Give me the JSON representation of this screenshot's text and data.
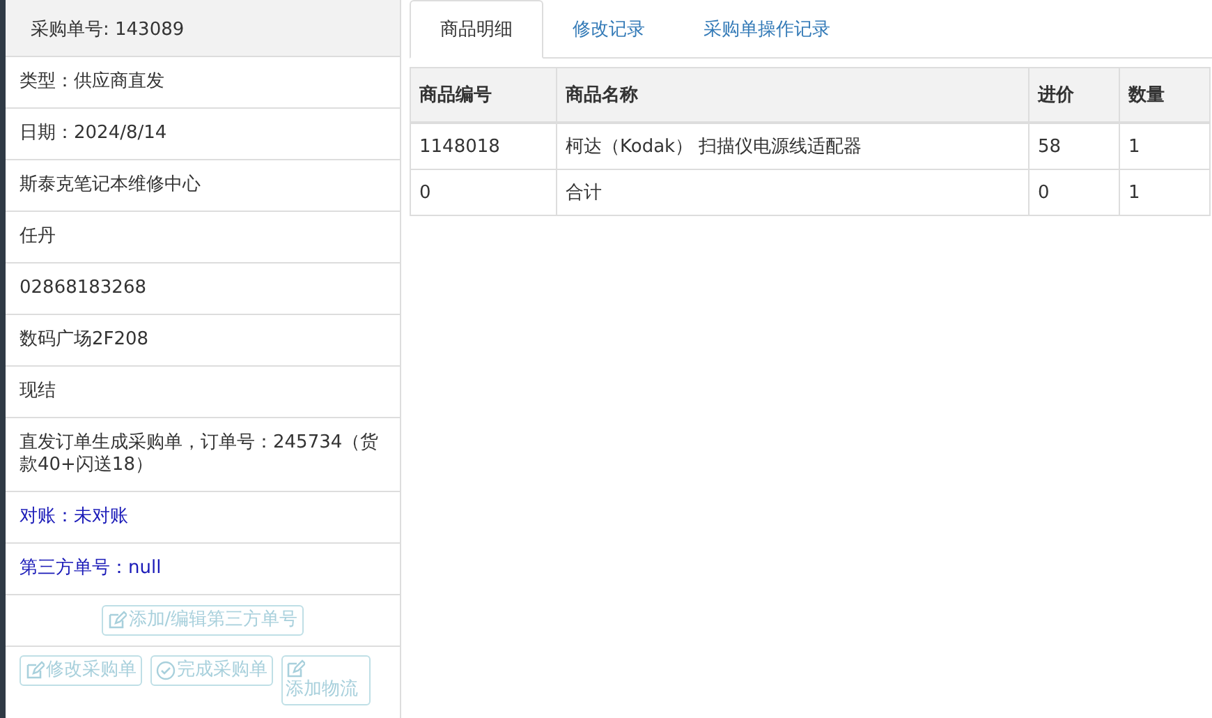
{
  "order_title": "采购单号: 143089",
  "details": [
    {
      "text": "类型：供应商直发",
      "kind": "plain"
    },
    {
      "text": "日期：2024/8/14",
      "kind": "plain"
    },
    {
      "text": "斯泰克笔记本维修中心",
      "kind": "plain"
    },
    {
      "text": "任丹",
      "kind": "plain"
    },
    {
      "text": "02868183268",
      "kind": "plain"
    },
    {
      "text": "数码广场2F208",
      "kind": "plain"
    },
    {
      "text": "现结",
      "kind": "plain"
    },
    {
      "text": "直发订单生成采购单，订单号：245734（货款40+闪送18）",
      "kind": "plain"
    },
    {
      "text": "对账：未对账",
      "kind": "link"
    },
    {
      "text": "第三方单号：null",
      "kind": "link"
    }
  ],
  "third_party_button": {
    "label": "添加/编辑第三方单号",
    "kind": "edit",
    "disabled": true
  },
  "action_buttons": [
    {
      "label": "修改采购单",
      "kind": "edit",
      "disabled": true
    },
    {
      "label": "完成采购单",
      "kind": "check",
      "disabled": true
    },
    {
      "label": "添加物流",
      "kind": "edit",
      "disabled": true
    }
  ],
  "tabs": [
    {
      "label": "商品明细",
      "selected": true
    },
    {
      "label": "修改记录",
      "selected": false
    },
    {
      "label": "采购单操作记录",
      "selected": false
    }
  ],
  "table": {
    "columns": [
      "商品编号",
      "商品名称",
      "进价",
      "数量"
    ],
    "rows": [
      [
        "1148018",
        "柯达（Kodak） 扫描仪电源线适配器",
        "58",
        "1"
      ],
      [
        "0",
        "合计",
        "0",
        "1"
      ]
    ]
  }
}
